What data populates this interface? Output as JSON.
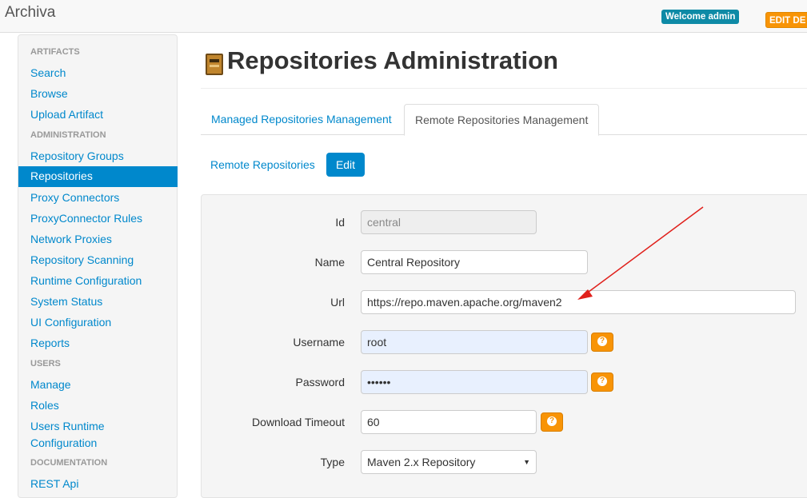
{
  "app": {
    "brand": "Archiva"
  },
  "header": {
    "welcome": "Welcome admin",
    "edit": "EDIT DE"
  },
  "sidebar": {
    "sections": [
      {
        "header": "ARTIFACTS",
        "items": [
          "Search",
          "Browse",
          "Upload Artifact"
        ]
      },
      {
        "header": "ADMINISTRATION",
        "items": [
          "Repository Groups",
          "Repositories",
          "Proxy Connectors",
          "ProxyConnector Rules",
          "Network Proxies",
          "Repository Scanning",
          "Runtime Configuration",
          "System Status",
          "UI Configuration",
          "Reports"
        ]
      },
      {
        "header": "USERS",
        "items": [
          "Manage",
          "Roles",
          "Users Runtime Configuration"
        ]
      },
      {
        "header": "DOCUMENTATION",
        "items": [
          "REST Api"
        ]
      }
    ],
    "artifacts_header": "ARTIFACTS",
    "search": "Search",
    "browse": "Browse",
    "upload": "Upload Artifact",
    "admin_header": "ADMINISTRATION",
    "repo_groups": "Repository Groups",
    "repositories": "Repositories",
    "proxy_connectors": "Proxy Connectors",
    "proxy_rules": "ProxyConnector Rules",
    "network_proxies": "Network Proxies",
    "repo_scanning": "Repository Scanning",
    "runtime_config": "Runtime Configuration",
    "system_status": "System Status",
    "ui_config": "UI Configuration",
    "reports": "Reports",
    "users_header": "USERS",
    "manage": "Manage",
    "roles": "Roles",
    "users_runtime_1": "Users Runtime",
    "users_runtime_2": "Configuration",
    "docs_header": "DOCUMENTATION",
    "rest_api": "REST Api"
  },
  "main": {
    "title": "Repositories Administration",
    "tabs": {
      "managed": "Managed Repositories Management",
      "remote": "Remote Repositories Management"
    },
    "subnav": {
      "remote_repos": "Remote Repositories",
      "edit": "Edit"
    },
    "form": {
      "id_label": "Id",
      "id_value": "central",
      "name_label": "Name",
      "name_value": "Central Repository",
      "url_label": "Url",
      "url_value": "https://repo.maven.apache.org/maven2",
      "username_label": "Username",
      "username_value": "root",
      "password_label": "Password",
      "password_value": "••••••",
      "timeout_label": "Download Timeout",
      "timeout_value": "60",
      "type_label": "Type",
      "type_value": "Maven 2.x Repository"
    }
  },
  "icons": {
    "help": "question-circle-icon",
    "title": "repository-cabinet-icon",
    "annotation": "red-arrow-annotation"
  },
  "colors": {
    "link": "#0088cc",
    "help": "#f89406",
    "annotation": "#e0201b"
  }
}
